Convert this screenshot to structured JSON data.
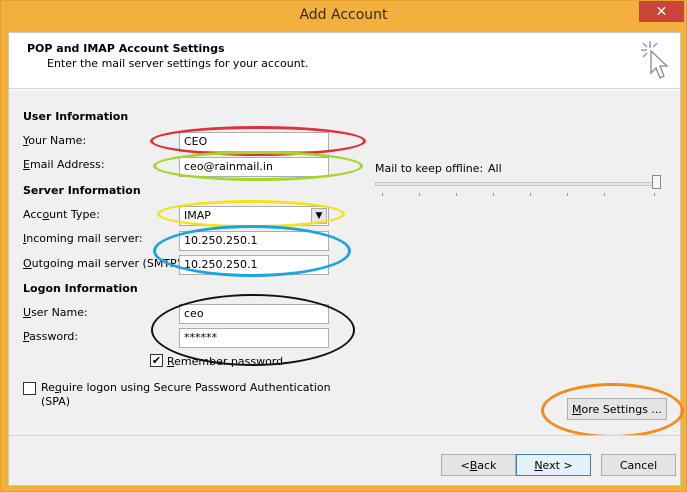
{
  "window": {
    "title": "Add Account",
    "close_glyph": "✕"
  },
  "header": {
    "title": "POP and IMAP Account Settings",
    "subtitle": "Enter the mail server settings for your account.",
    "icon": "cursor-sparkle-icon"
  },
  "user_info": {
    "heading": "User Information",
    "name_label_u": "Y",
    "name_label_rest": "our Name:",
    "name_value": "CEO",
    "email_label_u": "E",
    "email_label_rest": "mail Address:",
    "email_value": "ceo@rainmail.in"
  },
  "server_info": {
    "heading": "Server Information",
    "account_type_label_pre": "Acc",
    "account_type_label_u": "o",
    "account_type_label_rest": "unt Type:",
    "account_type_value": "IMAP",
    "incoming_label_u": "I",
    "incoming_label_rest": "ncoming mail server:",
    "incoming_value": "10.250.250.1",
    "outgoing_label_pre": "",
    "outgoing_label_u": "O",
    "outgoing_label_rest": "utgoing mail server (SMTP):",
    "outgoing_value": "10.250.250.1"
  },
  "logon_info": {
    "heading": "Logon Information",
    "user_label_u": "U",
    "user_label_rest": "ser Name:",
    "user_value": "ceo",
    "password_label_u": "P",
    "password_label_rest": "assword:",
    "password_value": "******",
    "remember_label_u": "R",
    "remember_label_rest": "emember password",
    "remember_checked": true,
    "spa_label_u": "q",
    "spa_label_pre": "Re",
    "spa_label_rest": "uire logon using Secure Password Authentication",
    "spa_label_line2": "(SPA)",
    "spa_checked": false
  },
  "offline": {
    "label": "Mail to keep offline:",
    "value": "All",
    "slider_fraction": 1.0
  },
  "buttons": {
    "more_settings_u": "M",
    "more_settings_rest": "ore Settings ...",
    "back_pre": "< ",
    "back_u": "B",
    "back_rest": "ack",
    "next_u": "N",
    "next_rest": "ext >",
    "cancel": "Cancel"
  },
  "annotations": {
    "colors": {
      "red": "#e0303a",
      "lime": "#a7d62a",
      "yellow": "#f2e21c",
      "blue": "#1ea4dc",
      "black": "#111111",
      "orange": "#f28a1c"
    }
  },
  "colors": {
    "titlebar": "#f3b03c",
    "close": "#c9453a",
    "default_button_border": "#3c7fb1"
  }
}
